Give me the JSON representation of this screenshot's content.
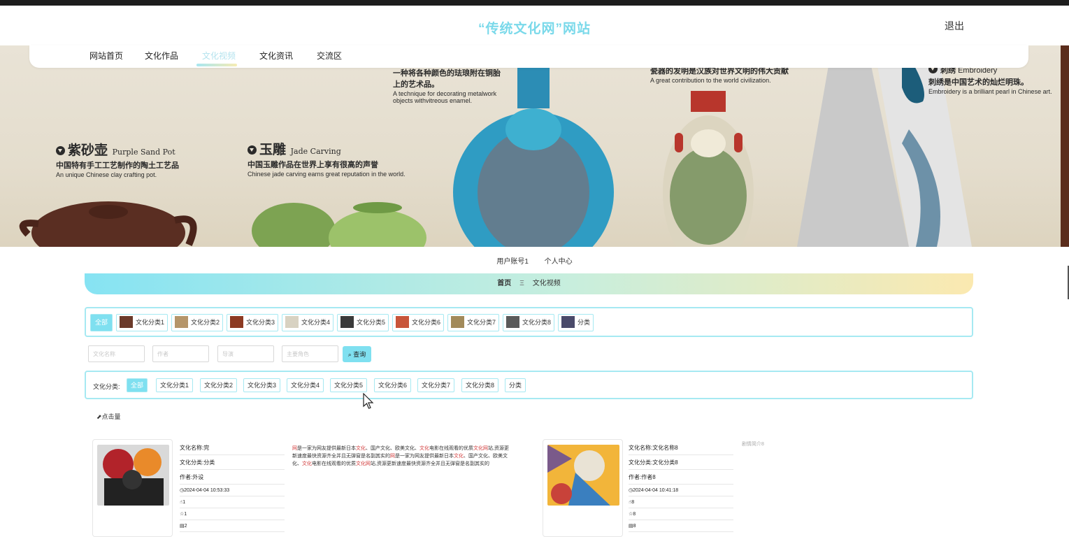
{
  "header": {
    "site_title": "“传统文化网”网站",
    "logout": "退出"
  },
  "nav": {
    "items": [
      {
        "label": "网站首页"
      },
      {
        "label": "文化作品"
      },
      {
        "label": "文化视频",
        "active": true
      },
      {
        "label": "文化资讯"
      },
      {
        "label": "交流区"
      }
    ]
  },
  "banner": {
    "captions": [
      {
        "title": "紫砂壶",
        "title_en": "Purple Sand Pot",
        "cn": "中国特有手工工艺制作的陶土工艺品",
        "en": "An unique Chinese clay crafting pot."
      },
      {
        "title": "玉雕",
        "title_en": "Jade Carving",
        "cn": "中国玉雕作品在世界上享有很高的声誉",
        "en": "Chinese jade carving earns great reputation in the world."
      },
      {
        "cn": "一种将各种颜色的珐琅附在铜胎上的艺术品。",
        "en": "A technique for decorating metalwork objects withvitreous enamel."
      },
      {
        "cn": "瓷器的发明是汉族对世界文明的伟大贡献",
        "en": "A great contribution to the world civilization."
      },
      {
        "title": "刺绣",
        "title_en": "Embroidery",
        "cn": "刺绣是中国艺术的灿烂明珠。",
        "en": "Embroidery is a brilliant pearl in Chinese art."
      }
    ]
  },
  "user_bar": {
    "account": "用户账号1",
    "center": "个人中心"
  },
  "breadcrumb": {
    "home": "首页",
    "separator": "Ξ",
    "current": "文化视频"
  },
  "categories": {
    "all": "全部",
    "items": [
      {
        "label": "文化分类1"
      },
      {
        "label": "文化分类2"
      },
      {
        "label": "文化分类3"
      },
      {
        "label": "文化分类4"
      },
      {
        "label": "文化分类5"
      },
      {
        "label": "文化分类6"
      },
      {
        "label": "文化分类7"
      },
      {
        "label": "文化分类8"
      },
      {
        "label": "分类"
      }
    ]
  },
  "search": {
    "name_placeholder": "文化名称",
    "author_placeholder": "作者",
    "director_placeholder": "导演",
    "actor_placeholder": "主要角色",
    "button": "查询"
  },
  "filter": {
    "label": "文化分类:",
    "all": "全部",
    "items": [
      "文化分类1",
      "文化分类2",
      "文化分类3",
      "文化分类4",
      "文化分类5",
      "文化分类6",
      "文化分类7",
      "文化分类8",
      "分类"
    ]
  },
  "sort": {
    "label": "点击量"
  },
  "list": [
    {
      "name": "文化名称:完",
      "category": "文化分类:分类",
      "author": "作者:外设",
      "time": "2024-04-04 10:53:33",
      "likes": "1",
      "favorites": "1",
      "clicks": "2",
      "desc_parts": [
        {
          "t": "网",
          "r": true
        },
        {
          "t": "是一家为网友提供最新日本"
        },
        {
          "t": "文化",
          "r": true
        },
        {
          "t": "、国产文化、欧美文化、"
        },
        {
          "t": "文化",
          "r": true
        },
        {
          "t": "电影在线观看的优质"
        },
        {
          "t": "文化网",
          "r": true
        },
        {
          "t": "站,资源更新速度最快资源齐全并且无弹窗是名副其实的"
        },
        {
          "t": "网",
          "r": true
        },
        {
          "t": "是一家为网友提供最新日本"
        },
        {
          "t": "文化",
          "r": true
        },
        {
          "t": "、国产文化、欧美文化、"
        },
        {
          "t": "文化",
          "r": true
        },
        {
          "t": "电影在线观看的优质"
        },
        {
          "t": "文化网",
          "r": true
        },
        {
          "t": "站,资源更新速度最快资源齐全并且无弹窗是名副其实的"
        }
      ]
    },
    {
      "name": "文化名称:文化名称8",
      "category": "文化分类:文化分类8",
      "author": "作者:作者8",
      "time": "2024-04-04 10:41:18",
      "likes": "8",
      "favorites": "8",
      "clicks": "8",
      "brief_label": "剧情简介8"
    }
  ],
  "colors": {
    "accent": "#7fe0f0",
    "accent_border": "#a6e9f2",
    "title": "#7ad9ea",
    "highlight_red": "#d23b3b"
  }
}
